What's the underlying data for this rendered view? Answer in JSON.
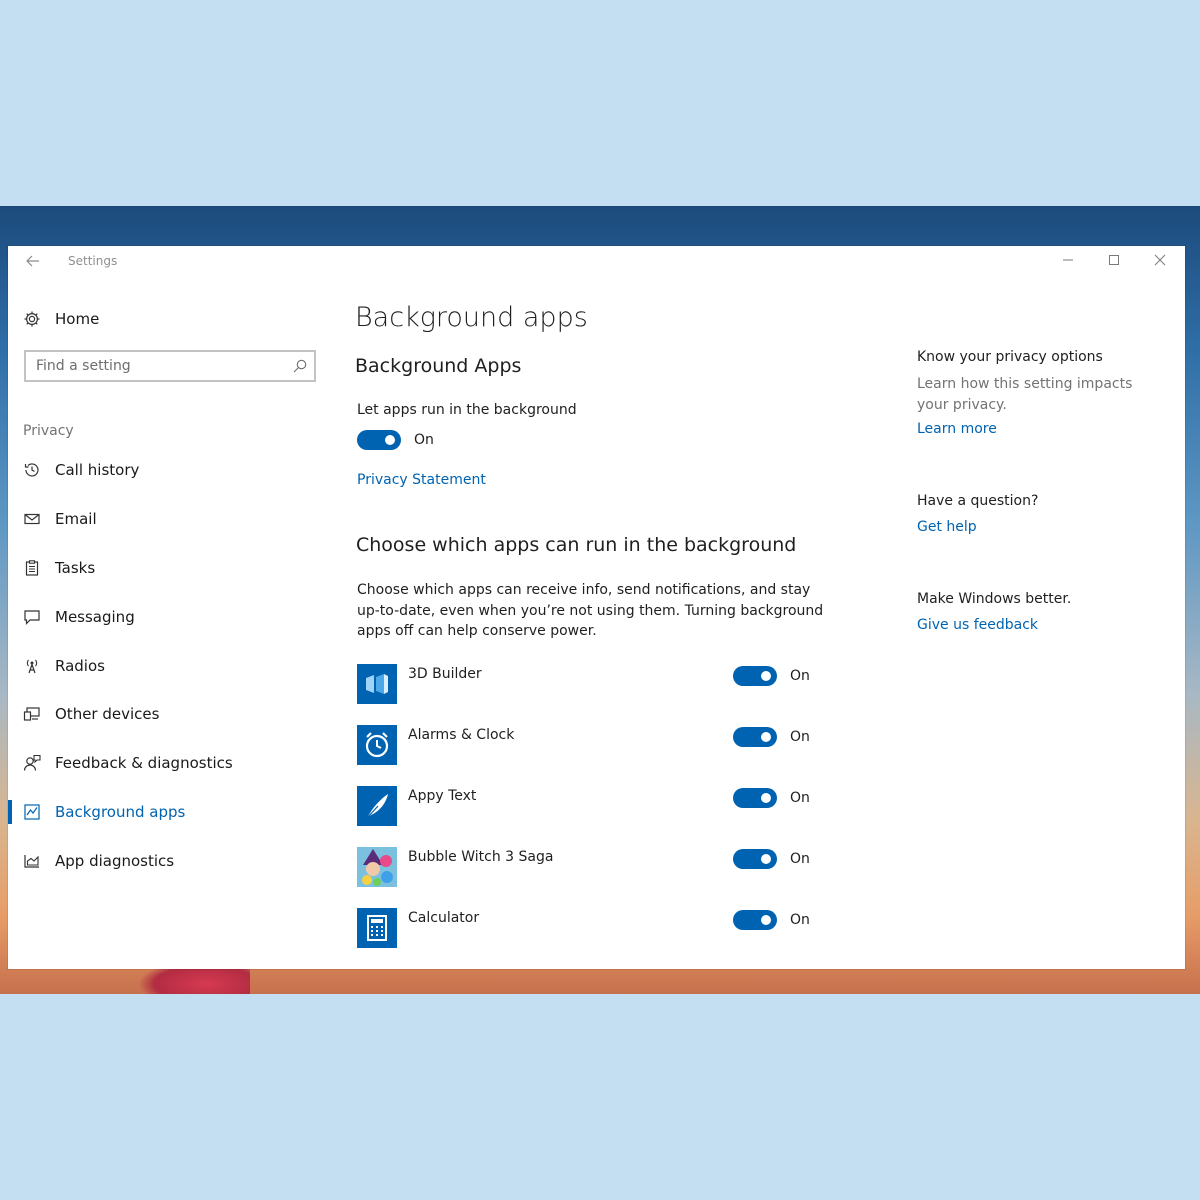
{
  "window": {
    "title": "Settings",
    "accent": "#0063b1"
  },
  "sidebar": {
    "home": {
      "label": "Home",
      "icon": "gear-icon"
    },
    "search": {
      "placeholder": "Find a setting",
      "value": ""
    },
    "section": "Privacy",
    "items": [
      {
        "label": "Call history",
        "icon": "history-icon",
        "active": false
      },
      {
        "label": "Email",
        "icon": "mail-icon",
        "active": false
      },
      {
        "label": "Tasks",
        "icon": "clipboard-icon",
        "active": false
      },
      {
        "label": "Messaging",
        "icon": "chat-icon",
        "active": false
      },
      {
        "label": "Radios",
        "icon": "antenna-icon",
        "active": false
      },
      {
        "label": "Other devices",
        "icon": "devices-icon",
        "active": false
      },
      {
        "label": "Feedback & diagnostics",
        "icon": "person-feedback-icon",
        "active": false
      },
      {
        "label": "Background apps",
        "icon": "background-apps-icon",
        "active": true
      },
      {
        "label": "App diagnostics",
        "icon": "chart-icon",
        "active": false
      }
    ]
  },
  "main": {
    "title": "Background apps",
    "subtitle": "Background Apps",
    "master_setting": {
      "label": "Let apps run in the background",
      "state": "On",
      "on": true
    },
    "privacy_link": "Privacy Statement",
    "choose_heading": "Choose which apps can run in the background",
    "description": "Choose which apps can receive info, send notifications, and stay up-to-date, even when you’re not using them. Turning background apps off can help conserve power.",
    "apps": [
      {
        "name": "3D Builder",
        "state": "On",
        "on": true,
        "icon": "3d-builder-icon"
      },
      {
        "name": "Alarms & Clock",
        "state": "On",
        "on": true,
        "icon": "alarm-clock-icon"
      },
      {
        "name": "Appy Text",
        "state": "On",
        "on": true,
        "icon": "feather-icon"
      },
      {
        "name": "Bubble Witch 3 Saga",
        "state": "On",
        "on": true,
        "icon": "bubble-witch-icon"
      },
      {
        "name": "Calculator",
        "state": "On",
        "on": true,
        "icon": "calculator-icon"
      }
    ]
  },
  "right": {
    "privacy": {
      "heading": "Know your privacy options",
      "text": "Learn how this setting impacts your privacy.",
      "link": "Learn more"
    },
    "question": {
      "heading": "Have a question?",
      "link": "Get help"
    },
    "feedback": {
      "heading": "Make Windows better.",
      "link": "Give us feedback"
    }
  }
}
